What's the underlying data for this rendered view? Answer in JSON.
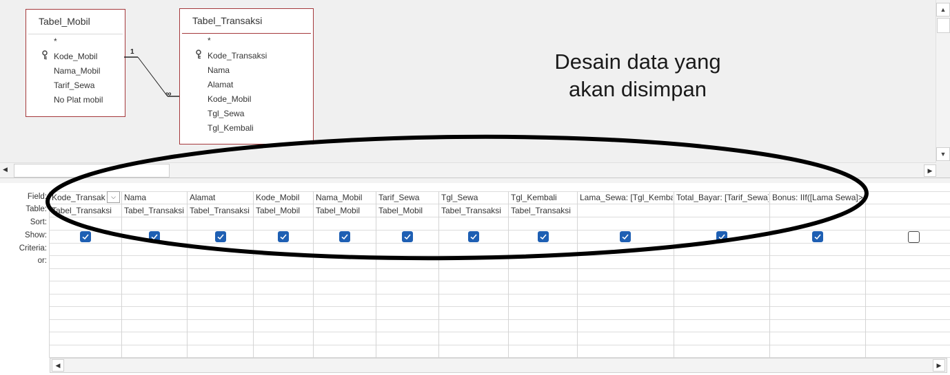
{
  "tables": [
    {
      "title": "Tabel_Mobil",
      "star": "*",
      "fields": [
        {
          "name": "Kode_Mobil",
          "key": true
        },
        {
          "name": "Nama_Mobil",
          "key": false
        },
        {
          "name": "Tarif_Sewa",
          "key": false
        },
        {
          "name": "No Plat mobil",
          "key": false
        }
      ]
    },
    {
      "title": "Tabel_Transaksi",
      "star": "*",
      "fields": [
        {
          "name": "Kode_Transaksi",
          "key": true
        },
        {
          "name": "Nama",
          "key": false
        },
        {
          "name": "Alamat",
          "key": false
        },
        {
          "name": "Kode_Mobil",
          "key": false
        },
        {
          "name": "Tgl_Sewa",
          "key": false
        },
        {
          "name": "Tgl_Kembali",
          "key": false
        }
      ]
    }
  ],
  "relationship": {
    "one_label": "1",
    "many_label": "∞"
  },
  "callout": {
    "line1": "Desain data yang",
    "line2": "akan disimpan"
  },
  "row_labels": {
    "field": "Field:",
    "table": "Table:",
    "sort": "Sort:",
    "show": "Show:",
    "criteria": "Criteria:",
    "or": "or:"
  },
  "columns": [
    {
      "field": "Kode_Transaksi",
      "table": "Tabel_Transaksi",
      "show": true
    },
    {
      "field": "Nama",
      "table": "Tabel_Transaksi",
      "show": true
    },
    {
      "field": "Alamat",
      "table": "Tabel_Transaksi",
      "show": true
    },
    {
      "field": "Kode_Mobil",
      "table": "Tabel_Mobil",
      "show": true
    },
    {
      "field": "Nama_Mobil",
      "table": "Tabel_Mobil",
      "show": true
    },
    {
      "field": "Tarif_Sewa",
      "table": "Tabel_Mobil",
      "show": true
    },
    {
      "field": "Tgl_Sewa",
      "table": "Tabel_Transaksi",
      "show": true
    },
    {
      "field": "Tgl_Kembali",
      "table": "Tabel_Transaksi",
      "show": true
    },
    {
      "field": "Lama_Sewa: [Tgl_Kembali]",
      "table": "",
      "show": true
    },
    {
      "field": "Total_Bayar: [Tarif_Sewa]",
      "table": "",
      "show": true
    },
    {
      "field": "Bonus: IIf([Lama Sewa]>",
      "table": "",
      "show": true
    },
    {
      "field": "",
      "table": "",
      "show": false
    }
  ],
  "colors": {
    "table_border": "#a4373a",
    "checkbox": "#1e5fb3",
    "ellipse": "#000000"
  }
}
